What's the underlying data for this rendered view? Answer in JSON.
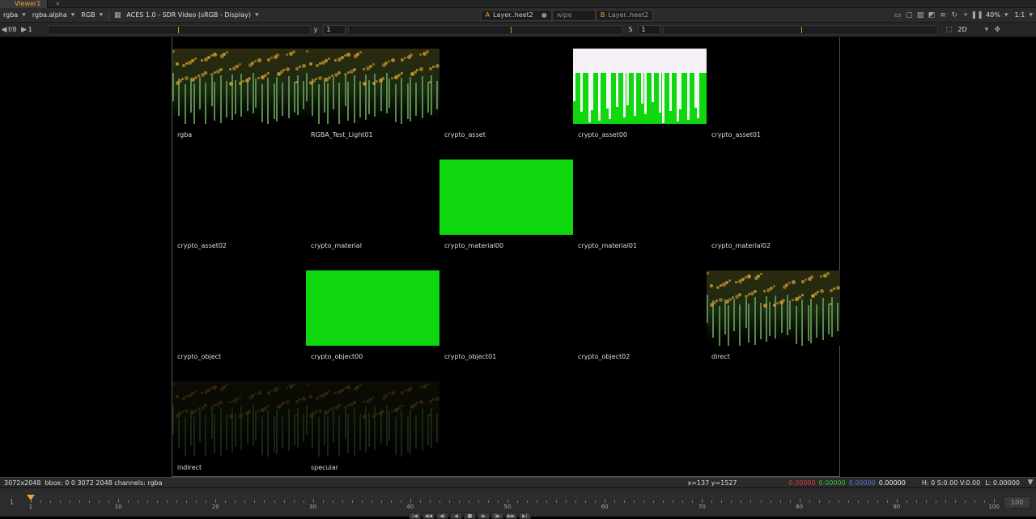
{
  "tab": {
    "title": "Viewer1"
  },
  "toolbar": {
    "channels": "rgba",
    "alpha_channel": "rgba.alpha",
    "display_channel": "RGB",
    "lut": "ACES 1.0 - SDR Video (sRGB - Display)",
    "input_a_prefix": "A",
    "input_a": "Layer..heet2",
    "wipe": "wipe",
    "input_b_prefix": "B",
    "input_b": "Layer..heet2",
    "zoom": "40%",
    "proxy": "1:1"
  },
  "controls": {
    "fstop": "f/8",
    "gain_value": "1",
    "gamma_label": "y",
    "gamma_value": "1",
    "saturation_label": "S",
    "saturation_value": "1",
    "view_mode": "2D"
  },
  "contact_sheet": [
    {
      "label": "rgba",
      "thumb": "flowers"
    },
    {
      "label": "RGBA_Test_Light01",
      "thumb": "flowers"
    },
    {
      "label": "crypto_asset",
      "thumb": "black"
    },
    {
      "label": "crypto_asset00",
      "thumb": "alpha"
    },
    {
      "label": "crypto_asset01",
      "thumb": "black"
    },
    {
      "label": "crypto_asset02",
      "thumb": "black"
    },
    {
      "label": "crypto_material",
      "thumb": "black"
    },
    {
      "label": "crypto_material00",
      "thumb": "green"
    },
    {
      "label": "crypto_material01",
      "thumb": "black"
    },
    {
      "label": "crypto_material02",
      "thumb": "black"
    },
    {
      "label": "crypto_object",
      "thumb": "black"
    },
    {
      "label": "crypto_object00",
      "thumb": "green"
    },
    {
      "label": "crypto_object01",
      "thumb": "black"
    },
    {
      "label": "crypto_object02",
      "thumb": "black"
    },
    {
      "label": "direct",
      "thumb": "flowers"
    },
    {
      "label": "indirect",
      "thumb": "flowers-dim"
    },
    {
      "label": "specular",
      "thumb": "flowers-dim"
    }
  ],
  "status": {
    "format": "3072x2048",
    "bbox_info": "bbox: 0 0 3072 2048 channels: rgba",
    "coords": "x=137 y=1527",
    "r": "0.00000",
    "g": "0.00000",
    "b": "0.00000",
    "a": "0.00000",
    "hsv": "H:  0 S:0.00 V:0.00",
    "luma": "L: 0.00000"
  },
  "timeline": {
    "start_frame": "1",
    "end_frame": "100",
    "current_frame": 1,
    "ticks": [
      "1",
      "10",
      "20",
      "30",
      "40",
      "50",
      "60",
      "70",
      "80",
      "90",
      "100"
    ]
  },
  "colors": {
    "accent": "#f0a030",
    "red": "#e03a3a",
    "green": "#3ac23a",
    "blue": "#4a7ae0"
  }
}
